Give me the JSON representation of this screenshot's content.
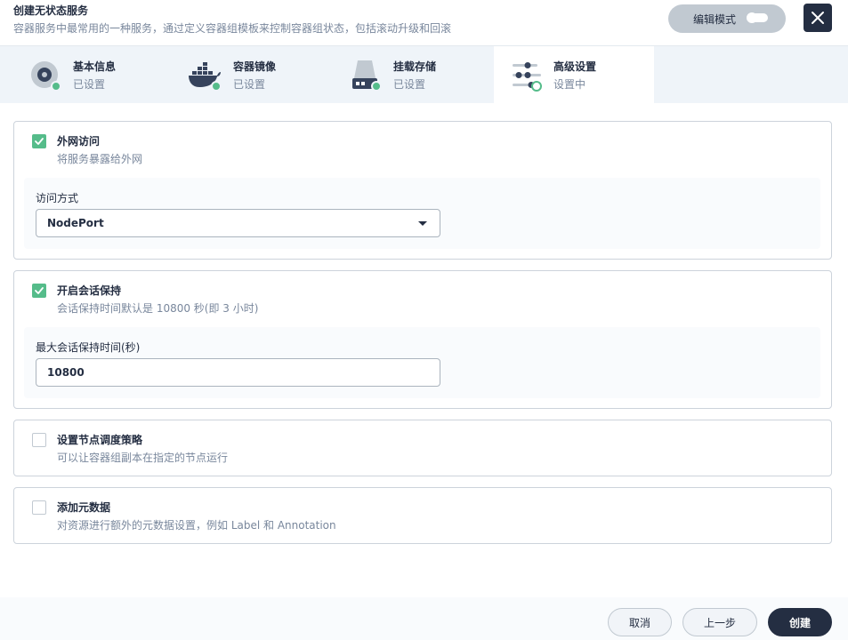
{
  "header": {
    "title": "创建无状态服务",
    "description": "容器服务中最常用的一种服务，通过定义容器组模板来控制容器组状态，包括滚动升级和回滚",
    "edit_mode_label": "编辑模式"
  },
  "steps": [
    {
      "name": "基本信息",
      "status": "已设置",
      "icon": "disc-icon"
    },
    {
      "name": "容器镜像",
      "status": "已设置",
      "icon": "docker-whale-icon"
    },
    {
      "name": "挂载存储",
      "status": "已设置",
      "icon": "storage-disk-icon"
    },
    {
      "name": "高级设置",
      "status": "设置中",
      "icon": "sliders-icon"
    }
  ],
  "sections": {
    "external_access": {
      "title": "外网访问",
      "description": "将服务暴露给外网",
      "checked": true,
      "field_label": "访问方式",
      "selected_value": "NodePort"
    },
    "session_affinity": {
      "title": "开启会话保持",
      "description": "会话保持时间默认是 10800 秒(即 3 小时)",
      "checked": true,
      "field_label": "最大会话保持时间(秒)",
      "value": "10800"
    },
    "node_scheduling": {
      "title": "设置节点调度策略",
      "description": "可以让容器组副本在指定的节点运行",
      "checked": false
    },
    "metadata": {
      "title": "添加元数据",
      "description": "对资源进行额外的元数据设置，例如 Label 和 Annotation",
      "checked": false
    }
  },
  "footer": {
    "cancel_label": "取消",
    "previous_label": "上一步",
    "create_label": "创建"
  },
  "colors": {
    "accent_green": "#55bc8a",
    "dark": "#242e42",
    "muted_text": "#79879c",
    "step_bar_bg": "#eff4f9"
  }
}
